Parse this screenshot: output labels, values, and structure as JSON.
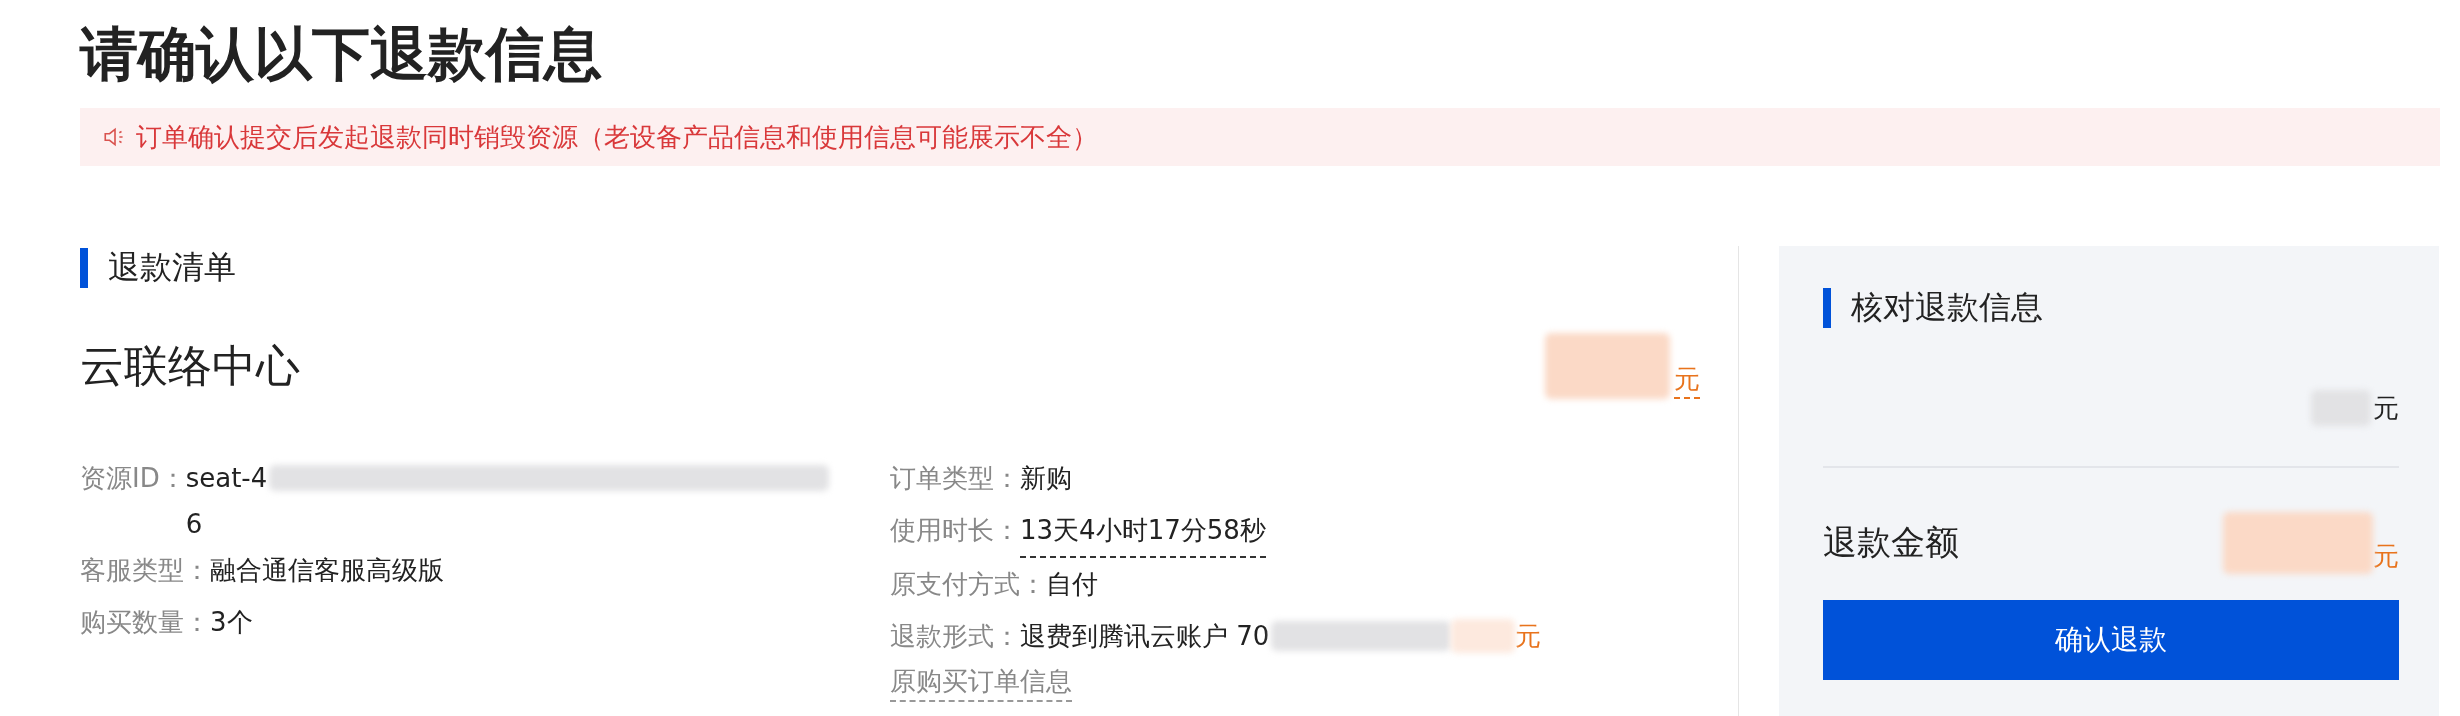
{
  "title": "请确认以下退款信息",
  "notice": {
    "text": "订单确认提交后发起退款同时销毁资源（老设备产品信息和使用信息可能展示不全）"
  },
  "refund_list": {
    "heading": "退款清单",
    "product": {
      "name": "云联络中心",
      "price_unit": "元"
    },
    "left_fields": [
      {
        "label": "资源ID：",
        "value": "seat-4",
        "redacted": true,
        "continuation": "6"
      },
      {
        "label": "客服类型：",
        "value": "融合通信客服高级版"
      },
      {
        "label": "购买数量：",
        "value": "3个"
      }
    ],
    "right_fields": [
      {
        "label": "订单类型：",
        "value": "新购",
        "kind": "plain"
      },
      {
        "label": "使用时长：",
        "value": "13天4小时17分58秒",
        "kind": "dotted"
      },
      {
        "label": "原支付方式：",
        "value": "自付",
        "kind": "plain"
      },
      {
        "label": "退款形式：",
        "value": "退费到腾讯云账户 70",
        "kind": "account",
        "unit": "元"
      }
    ],
    "order_link": "原购买订单信息"
  },
  "summary": {
    "heading": "核对退款信息",
    "row_unit": "元",
    "total_label": "退款金额",
    "total_unit": "元",
    "confirm_button": "确认退款"
  }
}
